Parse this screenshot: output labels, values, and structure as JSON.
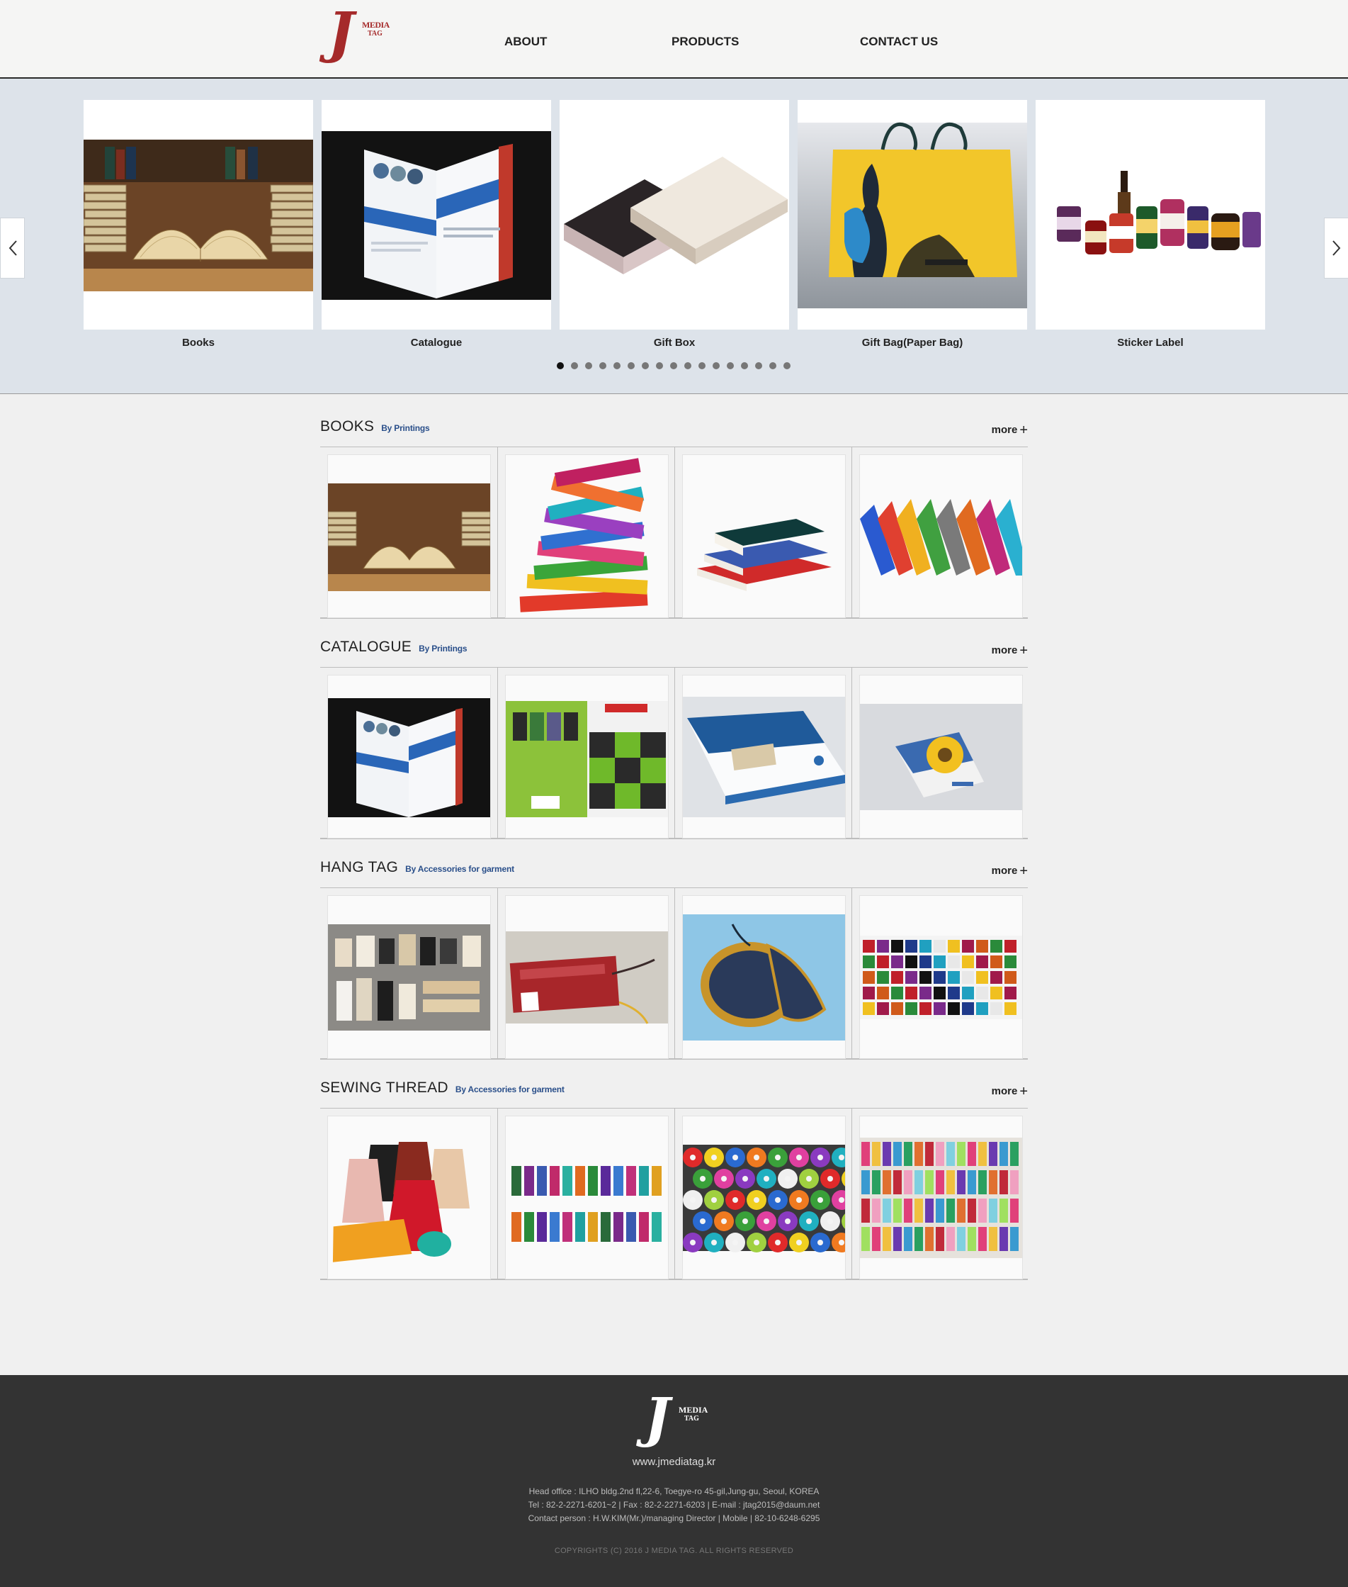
{
  "header": {
    "logo": {
      "letter": "J",
      "word1": "MEDIA",
      "word2": "TAG"
    },
    "nav": {
      "about": "ABOUT",
      "products": "PRODUCTS",
      "contact": "CONTACT US"
    }
  },
  "slider": {
    "slides": [
      {
        "caption": "Books"
      },
      {
        "caption": "Catalogue"
      },
      {
        "caption": "Gift Box"
      },
      {
        "caption": "Gift Bag(Paper Bag)"
      },
      {
        "caption": "Sticker Label"
      }
    ],
    "dot_count": 17,
    "active_dot": 1
  },
  "sections": [
    {
      "title": "BOOKS",
      "subtitle": "By Printings",
      "more": "more"
    },
    {
      "title": "CATALOGUE",
      "subtitle": "By Printings",
      "more": "more"
    },
    {
      "title": "HANG TAG",
      "subtitle": "By Accessories for garment",
      "more": "more"
    },
    {
      "title": "SEWING THREAD",
      "subtitle": "By Accessories for garment",
      "more": "more"
    }
  ],
  "footer": {
    "logo": {
      "letter": "J",
      "word1": "MEDIA",
      "word2": "TAG"
    },
    "site": "www.jmediatag.kr",
    "address": "Head office : ILHO bldg.2nd fl,22-6, Toegye-ro 45-gil,Jung-gu, Seoul, KOREA",
    "contact_line": "Tel : 82-2-2271-6201~2  |  Fax : 82-2-2271-6203  |  E-mail : jtag2015@daum.net",
    "person_line": "Contact person : H.W.KIM(Mr.)/managing Director  |  Mobile  |  82-10-6248-6295",
    "copyright": "COPYRIGHTS (C) 2016 J MEDIA TAG. ALL RIGHTS RESERVED"
  },
  "colors": {
    "brand_red": "#a52a2a",
    "slider_bg": "#dde3ea",
    "footer_bg": "#333333",
    "subtitle_blue": "#2a4f8a"
  }
}
